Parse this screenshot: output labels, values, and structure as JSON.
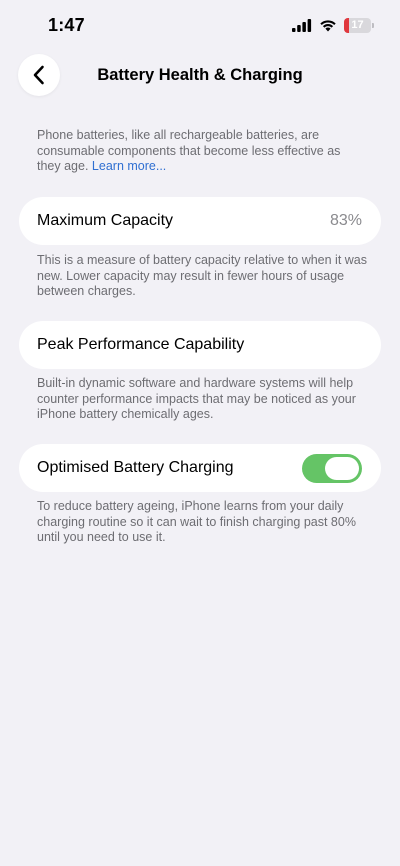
{
  "status_bar": {
    "time": "1:47",
    "battery_level": "17",
    "battery_fraction": 0.17,
    "icons": [
      "signal-icon",
      "wifi-icon",
      "battery-icon"
    ]
  },
  "nav": {
    "title": "Battery Health & Charging",
    "back_icon": "chevron-left-icon"
  },
  "intro": {
    "text": "Phone batteries, like all rechargeable batteries, are consumable components that become less effective as they age.",
    "link": "Learn more..."
  },
  "max_capacity": {
    "label": "Maximum Capacity",
    "value": "83%",
    "description": "This is a measure of battery capacity relative to when it was new. Lower capacity may result in fewer hours of usage between charges."
  },
  "peak_performance": {
    "label": "Peak Performance Capability",
    "description": "Built-in dynamic software and hardware systems will help counter performance impacts that may be noticed as your iPhone battery chemically ages."
  },
  "optimised_charging": {
    "label": "Optimised Battery Charging",
    "enabled": true,
    "description": "To reduce battery ageing, iPhone learns from your daily charging routine so it can wait to finish charging past 80% until you need to use it."
  },
  "colors": {
    "background": "#F2F1F6",
    "card": "#FFFFFF",
    "secondary_text": "#6D6D72",
    "link": "#2F6FD1",
    "toggle_on": "#65C466",
    "battery_low": "#E0383E"
  }
}
